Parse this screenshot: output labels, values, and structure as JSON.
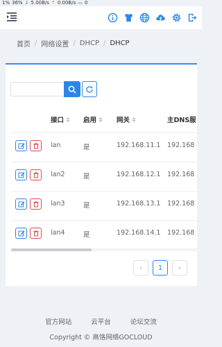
{
  "status_bar": {
    "battery": "1%",
    "signal": "36%",
    "down": "5.00B/s",
    "up": "0.00B/s",
    "count": "0"
  },
  "topbar": {
    "menu_icon": "menu-fold-icon",
    "icons": [
      "info-icon",
      "theme-shirt-icon",
      "globe-icon",
      "cloud-upload-icon",
      "gear-icon",
      "logout-icon"
    ],
    "accent": "#2b86e8"
  },
  "breadcrumb": {
    "items": [
      "首页",
      "网络设置",
      "DHCP",
      "DHCP"
    ],
    "separator": "/"
  },
  "search": {
    "placeholder": "",
    "value": ""
  },
  "table": {
    "columns": [
      "接口",
      "启用",
      "网关",
      "主DNS服"
    ],
    "rows": [
      {
        "iface": "lan",
        "enabled": "是",
        "gateway": "192.168.11.1",
        "dns": "192.168"
      },
      {
        "iface": "lan2",
        "enabled": "是",
        "gateway": "192.168.12.1",
        "dns": "192.168"
      },
      {
        "iface": "lan3",
        "enabled": "是",
        "gateway": "192.168.13.1",
        "dns": "192.168"
      },
      {
        "iface": "lan4",
        "enabled": "是",
        "gateway": "192.168.14.1",
        "dns": "192.168"
      }
    ]
  },
  "pagination": {
    "prev": "‹",
    "current": "1",
    "next": "›"
  },
  "footer": {
    "links": [
      "官方网站",
      "云平台",
      "论坛交流"
    ],
    "copyright": "Copyright © 高恪网络GOCLOUD"
  }
}
